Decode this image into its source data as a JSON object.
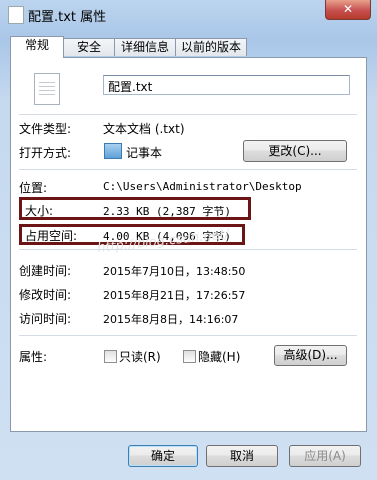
{
  "window": {
    "title": "配置.txt 属性",
    "close_label": "✕"
  },
  "tabs": [
    {
      "label": "常规"
    },
    {
      "label": "安全"
    },
    {
      "label": "详细信息"
    },
    {
      "label": "以前的版本"
    }
  ],
  "general": {
    "file_name": "配置.txt",
    "file_type_label": "文件类型:",
    "file_type_value": "文本文档 (.txt)",
    "opens_with_label": "打开方式:",
    "opens_with_value": "记事本",
    "change_button": "更改(C)...",
    "location_label": "位置:",
    "location_value": "C:\\Users\\Administrator\\Desktop",
    "size_label": "大小:",
    "size_value": "2.33 KB (2,387 字节)",
    "size_on_disk_label": "占用空间:",
    "size_on_disk_value": "4.00 KB (4,096 字节)",
    "created_label": "创建时间:",
    "created_value": "2015年7月10日，13:48:50",
    "modified_label": "修改时间:",
    "modified_value": "2015年8月21日，17:26:57",
    "accessed_label": "访问时间:",
    "accessed_value": "2015年8月8日，14:16:07",
    "attributes_label": "属性:",
    "readonly_label": "只读(R)",
    "hidden_label": "隐藏(H)",
    "advanced_button": "高级(D)...",
    "watermark": "http://blog.csdn.net/"
  },
  "buttons": {
    "ok": "确定",
    "cancel": "取消",
    "apply": "应用(A)"
  },
  "colors": {
    "highlight_box": "#6b1515",
    "title_bar": "#bcd4ee"
  }
}
